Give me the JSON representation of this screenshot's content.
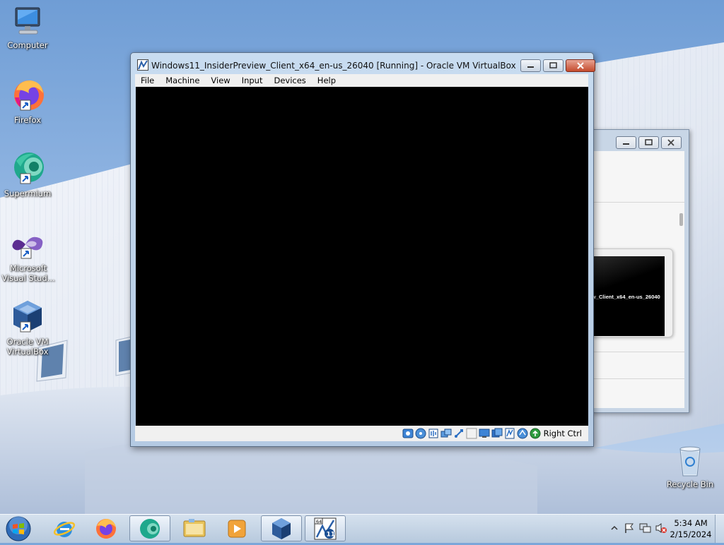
{
  "desktop": {
    "icons": [
      {
        "label": "Computer",
        "icon": "computer-icon"
      },
      {
        "label": "Firefox",
        "icon": "firefox-icon"
      },
      {
        "label": "Supermium",
        "icon": "supermium-icon"
      },
      {
        "label": "Microsoft Visual Stud...",
        "icon": "visual-studio-icon"
      },
      {
        "label": "Oracle VM VirtualBox",
        "icon": "virtualbox-icon"
      },
      {
        "label": "Recycle Bin",
        "icon": "recycle-bin-icon"
      }
    ]
  },
  "vm_window": {
    "title": "Windows11_InsiderPreview_Client_x64_en-us_26040 [Running] - Oracle VM VirtualBox",
    "menu": [
      "File",
      "Machine",
      "View",
      "Input",
      "Devices",
      "Help"
    ],
    "status_icons": [
      "hard-disk-icon",
      "optical-drive-icon",
      "audio-icon",
      "network-icon",
      "usb-icon",
      "shared-folders-icon",
      "display-icon",
      "video-capture-icon",
      "cpu-activity-icon",
      "guest-additions-icon",
      "mouse-integration-icon",
      "host-key-icon"
    ],
    "host_key": "Right Ctrl"
  },
  "bg_window": {
    "preview_text": "w_Client_x64_en-us_26040"
  },
  "taskbar": {
    "buttons": [
      "start-orb-icon",
      "internet-explorer-icon",
      "firefox-icon",
      "supermium-icon",
      "file-explorer-icon",
      "media-player-icon",
      "virtualbox-icon",
      "windows11-vm-icon"
    ],
    "clock_time": "5:34 AM",
    "clock_date": "2/15/2024"
  },
  "colors": {
    "title_bar": "#c8dcf0",
    "close_button": "#c44b2d",
    "vm_screen": "#000000",
    "taskbar": "#c7d6e8"
  }
}
